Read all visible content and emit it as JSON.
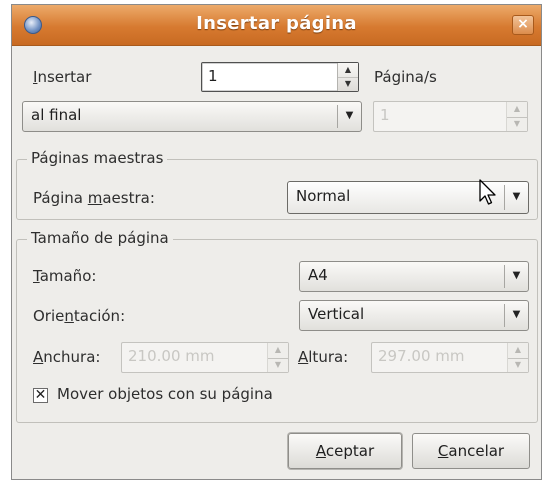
{
  "window": {
    "title": "Insertar página",
    "close_glyph": "×"
  },
  "insert": {
    "label_u": "I",
    "label_rest": "nsertar",
    "count_value": "1",
    "unit_label": "Página/s",
    "position_value": "al final",
    "page_number_value": "1"
  },
  "master": {
    "frame_title": "Páginas maestras",
    "label_pre": "Página ",
    "label_u": "m",
    "label_post": "aestra:",
    "value": "Normal"
  },
  "page_size": {
    "frame_title": "Tamaño de página",
    "size_label_u": "T",
    "size_label_rest": "amaño:",
    "size_value": "A4",
    "orientation_label_pre": "Orie",
    "orientation_label_u": "n",
    "orientation_label_post": "tación:",
    "orientation_value": "Vertical",
    "width_label_u": "A",
    "width_label_rest": "nchura:",
    "width_value": "210.00 mm",
    "height_label_u": "A",
    "height_label_rest": "ltura:",
    "height_value": "297.00 mm",
    "move_objects_label": "Mover objetos con su página",
    "move_objects_checked": true,
    "checkbox_glyph": "✕"
  },
  "buttons": {
    "accept_u": "A",
    "accept_rest": "ceptar",
    "cancel_u": "C",
    "cancel_rest": "ancelar"
  },
  "glyphs": {
    "up": "▲",
    "down": "▼"
  }
}
